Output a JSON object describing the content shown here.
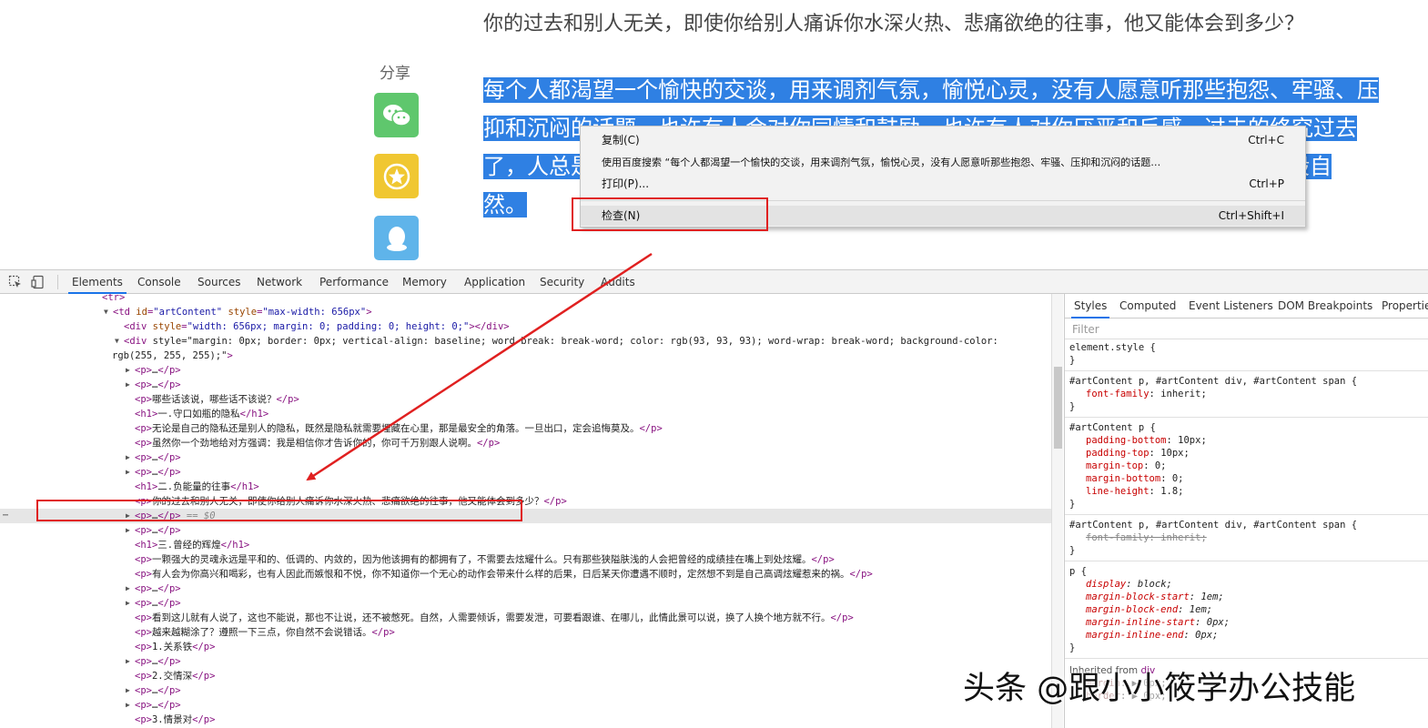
{
  "page": {
    "para1": "你的过去和别人无关，即使你给别人痛诉你水深火热、悲痛欲绝的往事，他又能体会到多少？",
    "share_label": "分享",
    "share_buttons": [
      {
        "icon": "wechat-icon",
        "color": "#5fc76d"
      },
      {
        "icon": "star-favorite-icon",
        "color": "#f0c732"
      },
      {
        "icon": "qq-icon",
        "color": "#5fb4ea"
      }
    ],
    "selected_lines": [
      "每个人都渴望一个愉快的交谈，用来调剂气氛，愉悦心灵，没有人愿意听那些抱怨、牢骚、压",
      "抑和沉闷的话题，也许有人会对你同情和鼓励，也许有人对你厌恶和反感，过去的终究过去",
      "了，人总是",
      "万般自",
      "然。"
    ],
    "selection_color": "#2f80e3"
  },
  "context_menu": {
    "items": [
      {
        "label": "复制(C)",
        "shortcut": "Ctrl+C"
      },
      {
        "label": "使用百度搜索 “每个人都渴望一个愉快的交谈，用来调剂气氛，愉悦心灵，没有人愿意听那些抱怨、牢骚、压抑和沉闷的话题…",
        "shortcut": ""
      },
      {
        "label": "打印(P)...",
        "shortcut": "Ctrl+P"
      },
      {
        "label": "检查(N)",
        "shortcut": "Ctrl+Shift+I"
      }
    ]
  },
  "devtools": {
    "tabs": [
      "Elements",
      "Console",
      "Sources",
      "Network",
      "Performance",
      "Memory",
      "Application",
      "Security",
      "Audits"
    ],
    "active_tab": "Elements",
    "elements_lines": [
      {
        "indent": 0,
        "tri": "",
        "html": "<tr>"
      },
      {
        "indent": 1,
        "tri": "▼",
        "html": "<td id=\"artContent\" style=\"max-width: 656px\">"
      },
      {
        "indent": 2,
        "tri": "",
        "html": "<div style=\"width: 656px; margin: 0; padding: 0; height: 0;\"></div>"
      },
      {
        "indent": 2,
        "tri": "▼",
        "html": "<div style=\"margin: 0px; border: 0px; vertical-align: baseline; word-break: break-word; color: rgb(93, 93, 93); word-wrap: break-word; background-color:"
      },
      {
        "indent": -1,
        "tri": "",
        "html": "rgb(255, 255, 255);\">"
      },
      {
        "indent": 3,
        "tri": "▶",
        "html": "<p>…</p>"
      },
      {
        "indent": 3,
        "tri": "▶",
        "html": "<p>…</p>"
      },
      {
        "indent": 3,
        "tri": "",
        "html": "<p>哪些话该说，哪些话不该说？</p>"
      },
      {
        "indent": 3,
        "tri": "",
        "html": "<h1>一.守口如瓶的隐私</h1>"
      },
      {
        "indent": 3,
        "tri": "",
        "html": "<p>无论是自己的隐私还是别人的隐私，既然是隐私就需要埋藏在心里，那是最安全的角落。一旦出口，定会追悔莫及。</p>"
      },
      {
        "indent": 3,
        "tri": "",
        "html": "<p>虽然你一个劲地给对方强调：我是相信你才告诉你的，你可千万别跟人说啊。</p>"
      },
      {
        "indent": 3,
        "tri": "▶",
        "html": "<p>…</p>"
      },
      {
        "indent": 3,
        "tri": "▶",
        "html": "<p>…</p>"
      },
      {
        "indent": 3,
        "tri": "",
        "html": "<h1>二.负能量的往事</h1>"
      },
      {
        "indent": 3,
        "tri": "",
        "html": "<p>你的过去和别人无关，即使你给别人痛诉你水深火热、悲痛欲绝的往事，他又能体会到多少？</p>"
      },
      {
        "indent": 3,
        "tri": "▶",
        "html": "<p>…</p>",
        "selected": true,
        "suffix": " == $0"
      },
      {
        "indent": 3,
        "tri": "▶",
        "html": "<p>…</p>"
      },
      {
        "indent": 3,
        "tri": "",
        "html": "<h1>三.曾经的辉煌</h1>"
      },
      {
        "indent": 3,
        "tri": "",
        "html": "<p>一颗强大的灵魂永远是平和的、低调的、内敛的，因为他该拥有的都拥有了，不需要去炫耀什么。只有那些狭隘肤浅的人会把曾经的成绩挂在嘴上到处炫耀。</p>"
      },
      {
        "indent": 3,
        "tri": "",
        "html": "<p>有人会为你高兴和喝彩，也有人因此而嫉恨和不悦，你不知道你一个无心的动作会带来什么样的后果，日后某天你遭遇不顺时，定然想不到是自己高调炫耀惹来的祸。</p>"
      },
      {
        "indent": 3,
        "tri": "▶",
        "html": "<p>…</p>"
      },
      {
        "indent": 3,
        "tri": "▶",
        "html": "<p>…</p>"
      },
      {
        "indent": 3,
        "tri": "",
        "html": "<p>看到这儿就有人说了，这也不能说，那也不让说，还不被憋死。自然，人需要倾诉，需要发泄，可要看跟谁、在哪儿，此情此景可以说，换了人换个地方就不行。</p>"
      },
      {
        "indent": 3,
        "tri": "",
        "html": "<p>越来越糊涂了？遵照一下三点，你自然不会说错话。</p>"
      },
      {
        "indent": 3,
        "tri": "",
        "html": "<p>1.关系铁</p>"
      },
      {
        "indent": 3,
        "tri": "▶",
        "html": "<p>…</p>"
      },
      {
        "indent": 3,
        "tri": "",
        "html": "<p>2.交情深</p>"
      },
      {
        "indent": 3,
        "tri": "▶",
        "html": "<p>…</p>"
      },
      {
        "indent": 3,
        "tri": "▶",
        "html": "<p>…</p>"
      },
      {
        "indent": 3,
        "tri": "",
        "html": "<p>3.情景对</p>"
      }
    ],
    "styles_tabs": [
      "Styles",
      "Computed",
      "Event Listeners",
      "DOM Breakpoints",
      "Properties"
    ],
    "styles_active_tab": "Styles",
    "filter_placeholder": "Filter",
    "css_rules": [
      {
        "selector": "element.style {",
        "decls": [],
        "close": "}"
      },
      {
        "selector": "#artContent p, #artContent div, #artContent span {",
        "decls": [
          {
            "p": "font-family",
            "v": "inherit;"
          }
        ],
        "close": "}"
      },
      {
        "selector": "#artContent p {",
        "decls": [
          {
            "p": "padding-bottom",
            "v": "10px;"
          },
          {
            "p": "padding-top",
            "v": "10px;"
          },
          {
            "p": "margin-top",
            "v": "0;"
          },
          {
            "p": "margin-bottom",
            "v": "0;"
          },
          {
            "p": "line-height",
            "v": "1.8;"
          }
        ],
        "close": "}"
      },
      {
        "selector": "#artContent p, #artContent div, #artContent span {",
        "decls": [
          {
            "p": "font-family",
            "v": "inherit;",
            "strike": true
          }
        ],
        "close": "}"
      },
      {
        "selector": "p {",
        "decls": [
          {
            "p": "display",
            "v": "block;",
            "ua": true
          },
          {
            "p": "margin-block-start",
            "v": "1em;",
            "ua": true
          },
          {
            "p": "margin-block-end",
            "v": "1em;",
            "ua": true
          },
          {
            "p": "margin-inline-start",
            "v": "0px;",
            "ua": true
          },
          {
            "p": "margin-inline-end",
            "v": "0px;",
            "ua": true
          }
        ],
        "close": "}"
      }
    ],
    "inherited_label": "Inherited from",
    "inherited_tag": "div",
    "inherited_decls": [
      {
        "p": "margin",
        "v": "▶ 0px;"
      },
      {
        "p": "border",
        "v": "▶ 0px;"
      }
    ]
  },
  "watermark": "头条 @跟小小筱学办公技能"
}
